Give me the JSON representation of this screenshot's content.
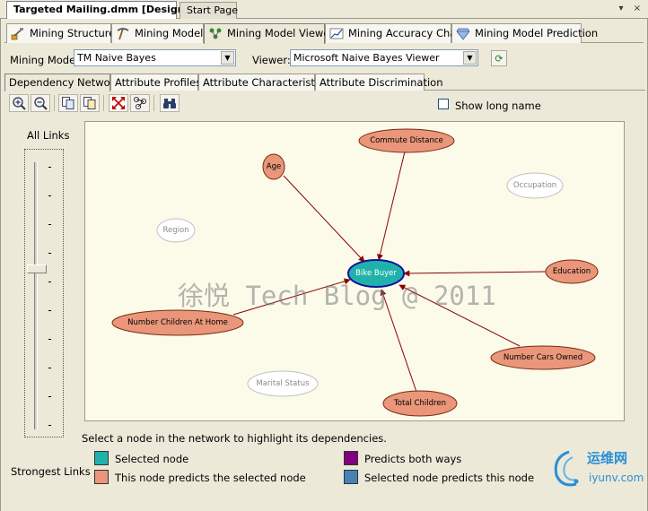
{
  "doc_tabs": [
    {
      "label": "Targeted Mailing.dmm [Design]"
    },
    {
      "label": "Start Page"
    }
  ],
  "window_buttons": {
    "dropdown": "▾",
    "close": "×"
  },
  "designer_tabs": [
    {
      "label": "Mining Structure",
      "icon": "mining-structure-icon"
    },
    {
      "label": "Mining Models",
      "icon": "pickaxe-icon"
    },
    {
      "label": "Mining Model Viewer",
      "icon": "model-viewer-icon"
    },
    {
      "label": "Mining Accuracy Chart",
      "icon": "accuracy-chart-icon"
    },
    {
      "label": "Mining Model Prediction",
      "icon": "diamond-icon"
    }
  ],
  "model_select": {
    "label": "Mining Model:",
    "value": "TM Naive Bayes"
  },
  "viewer_select": {
    "label": "Viewer:",
    "value": "Microsoft Naive Bayes Viewer"
  },
  "viewer_tabs": [
    {
      "label": "Dependency Network"
    },
    {
      "label": "Attribute Profiles"
    },
    {
      "label": "Attribute Characteristics"
    },
    {
      "label": "Attribute Discrimination"
    }
  ],
  "show_long_name": {
    "label": "Show long name",
    "checked": false
  },
  "slider": {
    "top_label": "All Links",
    "bottom_label": "Strongest Links",
    "level_fraction": 0.65
  },
  "network": {
    "nodes": {
      "bike_buyer": "Bike Buyer",
      "commute_distance": "Commute Distance",
      "age": "Age",
      "occupation": "Occupation",
      "region": "Region",
      "education": "Education",
      "number_children_at_home": "Number Children At Home",
      "number_cars_owned": "Number Cars Owned",
      "marital_status": "Marital Status",
      "total_children": "Total Children"
    }
  },
  "watermark": "徐悦 Tech Blog @ 2011",
  "hint": "Select a node in the network to highlight its dependencies.",
  "legend": [
    {
      "label": "Selected node",
      "color": "#20b2aa"
    },
    {
      "label": "This node predicts the selected node",
      "color": "#e9967a"
    },
    {
      "label": "Predicts both ways",
      "color": "#800080"
    },
    {
      "label": "Selected node predicts this node",
      "color": "#4682b4"
    }
  ],
  "logo": {
    "text_cn": "运维网",
    "text_url": "iyunv.com"
  },
  "colors": {
    "selected": "#20b2aa",
    "predicts_selected": "#e9967a",
    "both_ways": "#800080",
    "selected_predicts": "#4682b4",
    "edge": "#8b0000"
  }
}
